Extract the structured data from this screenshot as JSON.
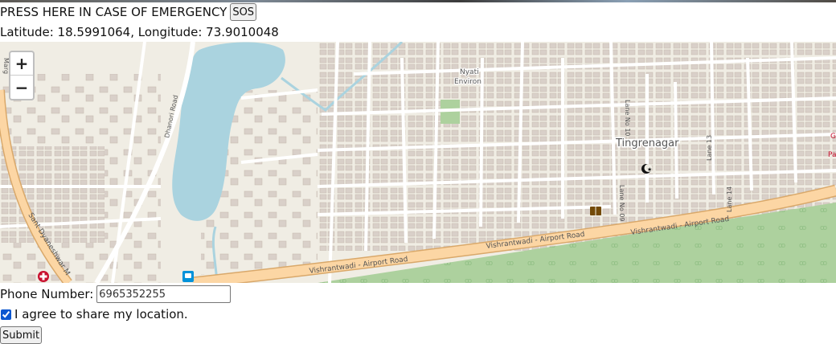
{
  "sos": {
    "prompt": "PRESS HERE IN CASE OF EMERGENCY",
    "button_label": "SOS"
  },
  "location": {
    "text": "Latitude: 18.5991064, Longitude: 73.9010048"
  },
  "map": {
    "zoom_in": "+",
    "zoom_out": "−",
    "labels": {
      "area_main": "Tingrenagar",
      "nyati": "Nyati",
      "environ": "Environ",
      "road_dhanori": "Dhanori Road",
      "road_vishrantwadi": "Vishrantwadi - Airport Road",
      "road_sant": "Sant Dyaneshwar M",
      "lane_10": "Lane No 10",
      "lane_09": "Lane No 09",
      "lane_13": "Lane 13",
      "lane_14": "Lane 14",
      "marg": "Marg"
    },
    "colors": {
      "land": "#f0ede4",
      "water": "#aad3df",
      "park": "#add19e",
      "building": "#d9d0c9",
      "major_road": "#fcd6a4",
      "minor_road": "#ffffff"
    }
  },
  "form": {
    "phone_label": "Phone Number:",
    "phone_value": "6965352255",
    "agree_label": "I agree to share my location.",
    "submit_label": "Submit"
  }
}
